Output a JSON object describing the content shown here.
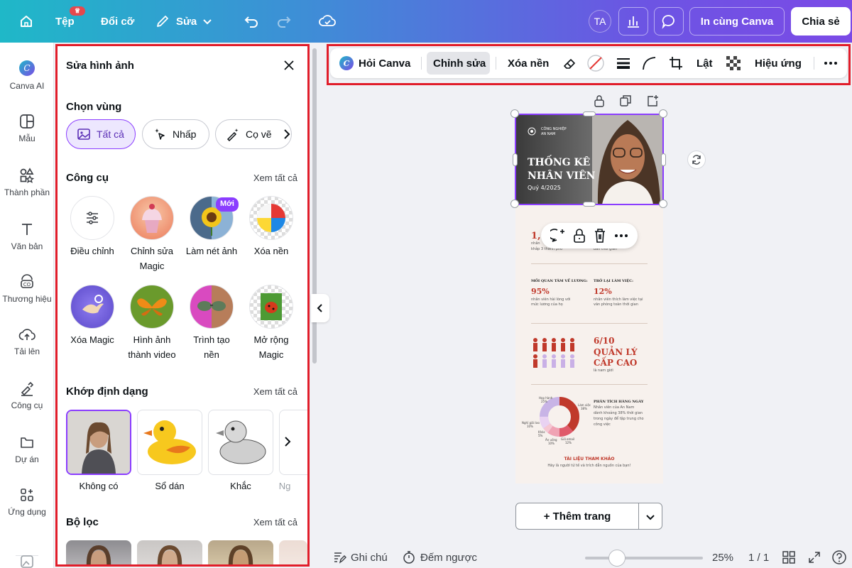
{
  "topbar": {
    "file": "Tệp",
    "file_badge": "ā)",
    "resize": "Đổi cỡ",
    "edit": "Sửa",
    "avatar": "TA",
    "print": "In cùng Canva",
    "share": "Chia sẻ"
  },
  "rail": [
    "Canva AI",
    "Mẫu",
    "Thành phần",
    "Văn bản",
    "Thương hiệu",
    "Tải lên",
    "Công cụ",
    "Dự án",
    "Ứng dụng"
  ],
  "panel": {
    "title": "Sửa hình ảnh",
    "select_area": "Chọn vùng",
    "chips": [
      "Tất cả",
      "Nhấp",
      "Cọ vẽ"
    ],
    "tools_title": "Công cụ",
    "see_all": "Xem tất cả",
    "new_badge": "Mới",
    "tools_row1": [
      {
        "l1": "Điều chỉnh",
        "l2": ""
      },
      {
        "l1": "Chỉnh sửa",
        "l2": "Magic"
      },
      {
        "l1": "Làm nét ảnh",
        "l2": ""
      },
      {
        "l1": "Xóa nền",
        "l2": ""
      }
    ],
    "tools_row2": [
      {
        "l1": "Xóa Magic",
        "l2": ""
      },
      {
        "l1": "Hình ảnh",
        "l2": "thành video"
      },
      {
        "l1": "Trình tạo",
        "l2": "nền"
      },
      {
        "l1": "Mở rộng",
        "l2": "Magic"
      }
    ],
    "styles_title": "Khớp định dạng",
    "styles": [
      "Không có",
      "Sổ dán",
      "Khắc",
      "Ng"
    ],
    "filters_title": "Bộ lọc"
  },
  "editbar": {
    "ask": "Hỏi Canva",
    "edit": "Chỉnh sửa",
    "bg_remove": "Xóa nền",
    "flip": "Lật",
    "effects": "Hiệu ứng"
  },
  "canvas": {
    "company": "CÔNG NGHIỆP",
    "company2": "AN NAM",
    "headline1": "THỐNG KÊ",
    "headline2": "NHÂN VIÊN",
    "quarter": "Quý 4/2025",
    "stat1_value": "1,0",
    "stat1_text": "nhân",
    "stat1_text2": "khắp 3 thành phố",
    "stat1b_text": "bán thời gian",
    "stat2_head": "MỐI QUAN TÂM VỀ LƯƠNG:",
    "stat2_value": "95%",
    "stat2_text": "nhân viên hài lòng với",
    "stat2_text2": "mức lương của họ",
    "stat3_head": "TRỞ LẠI LÀM VIỆC:",
    "stat3_value": "12%",
    "stat3_text": "nhân viên thích làm việc tại",
    "stat3_text2": "văn phòng toàn thời gian",
    "mgr_value": "6/10",
    "mgr_l1": "QUẢN LÝ",
    "mgr_l2": "CẤP CAO",
    "mgr_sub": "là nam giới",
    "daily_head": "PHÂN TÍCH HÀNG NGÀY",
    "daily_t1": "Nhân viên của An Nam",
    "daily_t2": "dành khoảng 38% thời gian",
    "daily_t3": "trong ngày để tập trung cho",
    "daily_t4": "công việc",
    "donut_meet": "Họp hành",
    "donut_meet_v": "25%",
    "donut_work": "Làm việc",
    "donut_work_v": "38%",
    "donut_rest": "Nghỉ giải lao",
    "donut_rest_v": "10%",
    "donut_other": "Khác",
    "donut_other_v": "5%",
    "donut_eat": "Ăn uống",
    "donut_eat_v": "10%",
    "donut_email": "Gửi email",
    "donut_email_v": "12%",
    "ref_title": "TÀI LIỆU THAM KHẢO",
    "ref_text": "Hãy là người tử tế và trích dẫn nguồn của bạn!",
    "add_page": "+ Thêm trang"
  },
  "bottombar": {
    "notes": "Ghi chú",
    "timer": "Đếm ngược",
    "zoom": "25%",
    "pages": "1 / 1",
    "zoom_level": 0.25
  },
  "colors": {
    "accent": "#8b3dff",
    "highlight": "#e11d2a",
    "infographic_red": "#c0392b"
  }
}
